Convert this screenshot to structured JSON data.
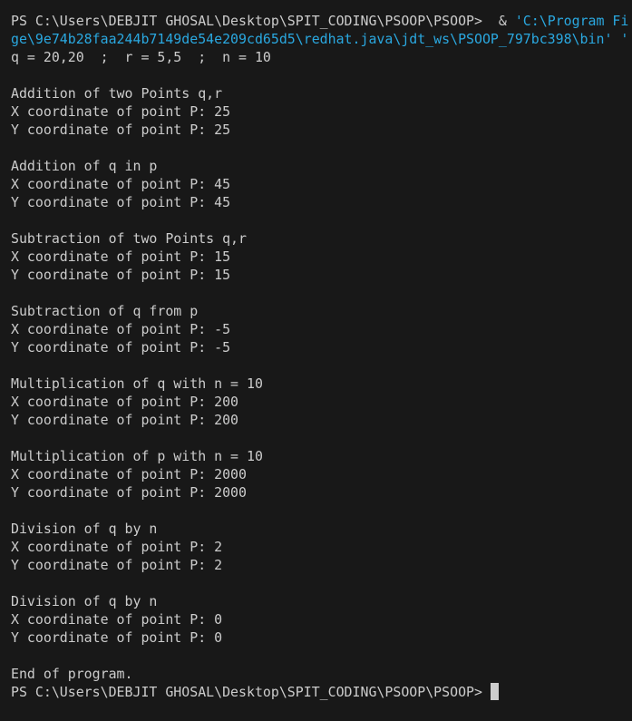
{
  "terminal": {
    "prompt": "PS C:\\Users\\DEBJIT GHOSAL\\Desktop\\SPIT_CODING\\PSOOP\\PSOOP>",
    "command_op": "  & ",
    "command_arg1": "'C:\\Program Fi",
    "command_line2": "ge\\9e74b28faa244b7149de54e209cd65d5\\redhat.java\\jdt_ws\\PSOOP_797bc398\\bin' ",
    "command_line2_tail": "'",
    "output": [
      "q = 20,20  ;  r = 5,5  ;  n = 10",
      "",
      "Addition of two Points q,r",
      "X coordinate of point P: 25",
      "Y coordinate of point P: 25",
      "",
      "Addition of q in p",
      "X coordinate of point P: 45",
      "Y coordinate of point P: 45",
      "",
      "Subtraction of two Points q,r",
      "X coordinate of point P: 15",
      "Y coordinate of point P: 15",
      "",
      "Subtraction of q from p",
      "X coordinate of point P: -5",
      "Y coordinate of point P: -5",
      "",
      "Multiplication of q with n = 10",
      "X coordinate of point P: 200",
      "Y coordinate of point P: 200",
      "",
      "Multiplication of p with n = 10",
      "X coordinate of point P: 2000",
      "Y coordinate of point P: 2000",
      "",
      "Division of q by n",
      "X coordinate of point P: 2",
      "Y coordinate of point P: 2",
      "",
      "Division of q by n",
      "X coordinate of point P: 0",
      "Y coordinate of point P: 0",
      "",
      "End of program."
    ],
    "final_prompt": "PS C:\\Users\\DEBJIT GHOSAL\\Desktop\\SPIT_CODING\\PSOOP\\PSOOP>"
  },
  "colors": {
    "background": "#181818",
    "text": "#cccccc",
    "string": "#2aa8e0"
  }
}
